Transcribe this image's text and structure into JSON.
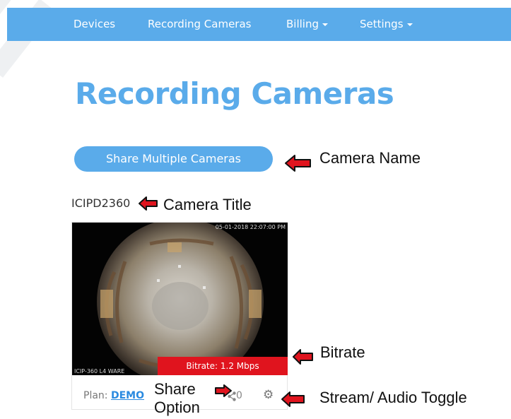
{
  "nav": {
    "items": [
      {
        "label": "Devices"
      },
      {
        "label": "Recording Cameras"
      },
      {
        "label": "Billing"
      },
      {
        "label": "Settings"
      }
    ]
  },
  "page": {
    "title": "Recording Cameras",
    "share_multiple_button": "Share Multiple Cameras"
  },
  "camera": {
    "title": "ICIPD2360",
    "bitrate": "Bitrate: 1.2 Mbps",
    "plan_label": "Plan:",
    "plan_value": "DEMO",
    "share_count": "0",
    "overlay_timestamp": "05-01-2018 22:07:00 PM",
    "overlay_label": "ICIP-360 L4 WARE"
  },
  "annotations": {
    "camera_name": "Camera Name",
    "camera_title": "Camera Title",
    "bitrate": "Bitrate",
    "share_option_line1": "Share",
    "share_option_line2": "Option",
    "stream_audio_toggle": "Stream/ Audio Toggle"
  },
  "colors": {
    "brand": "#5aabea",
    "bitrate_bg": "#e0141e",
    "link": "#2a8ae0",
    "callout_arrow": "#e0141e"
  },
  "icons": [
    "share-icon",
    "gear-icon",
    "caret-down-icon",
    "red-arrow-icon"
  ]
}
